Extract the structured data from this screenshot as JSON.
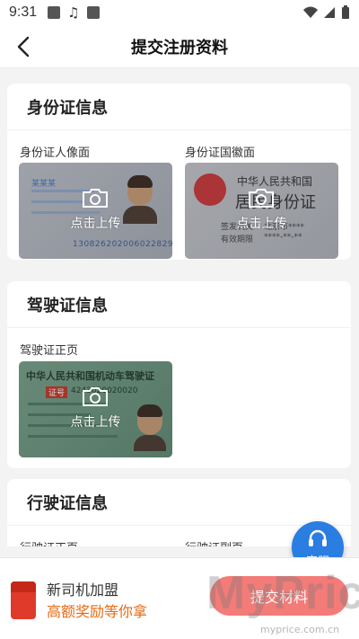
{
  "status": {
    "time": "9:31"
  },
  "header": {
    "title": "提交注册资料"
  },
  "sections": [
    {
      "title": "身份证信息",
      "fields": [
        {
          "label": "身份证人像面",
          "upload_text": "点击上传",
          "id_number": "130826202006022829",
          "name_text": "某某某"
        },
        {
          "label": "身份证国徽面",
          "upload_text": "点击上传",
          "country": "中华人民共和国",
          "doc": "居民身份证",
          "issuer_label": "签发机关",
          "issuer": "北京市****",
          "validity_label": "有效期限",
          "validity": "****-**-**"
        }
      ]
    },
    {
      "title": "驾驶证信息",
      "fields": [
        {
          "label": "驾驶证正页",
          "upload_text": "点击上传",
          "heading": "中华人民共和国机动车驾驶证",
          "cert_no": "证号",
          "number": "4243020020020"
        }
      ]
    },
    {
      "title": "行驶证信息",
      "fields": [
        {
          "label": "行驶证正页"
        },
        {
          "label": "行驶证副页"
        }
      ]
    }
  ],
  "service": {
    "label": "客服"
  },
  "bottom": {
    "promo_title": "新司机加盟",
    "promo_subtitle": "高额奖励等你拿",
    "submit_label": "提交材料"
  },
  "watermark": {
    "brand": "MyPrice",
    "url": "myprice.com.cn"
  },
  "colors": {
    "accent": "#f37b78",
    "promo": "#e86a12",
    "service": "#2a7de1"
  }
}
